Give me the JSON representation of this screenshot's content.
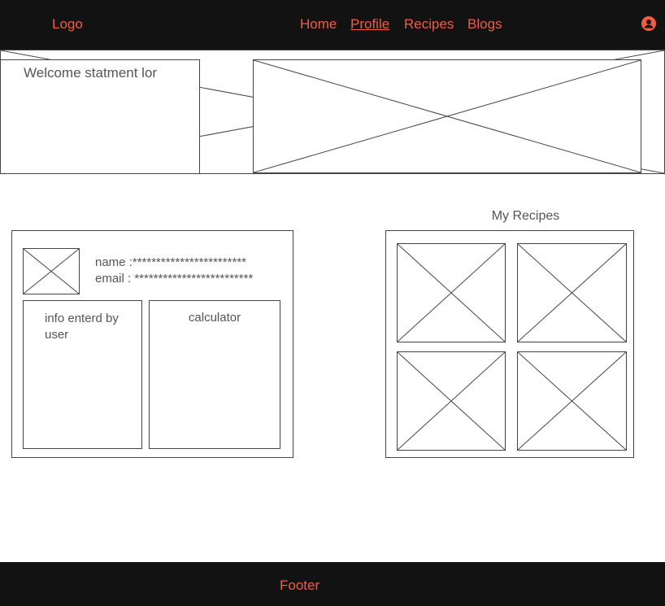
{
  "header": {
    "logo": "Logo",
    "nav": [
      {
        "label": "Home"
      },
      {
        "label": "Profile"
      },
      {
        "label": "Recipes"
      },
      {
        "label": "Blogs"
      }
    ],
    "user_icon": "user-circle-icon"
  },
  "hero": {
    "welcome": "Welcome statment lor"
  },
  "profile": {
    "name": "name :************************",
    "email": "email : *************************",
    "info": "info enterd by user",
    "calculator": "calculator"
  },
  "recipes": {
    "title": "My Recipes"
  },
  "footer": {
    "text": "Footer"
  },
  "colors": {
    "bar": "#121212",
    "accent": "#f25c44"
  }
}
